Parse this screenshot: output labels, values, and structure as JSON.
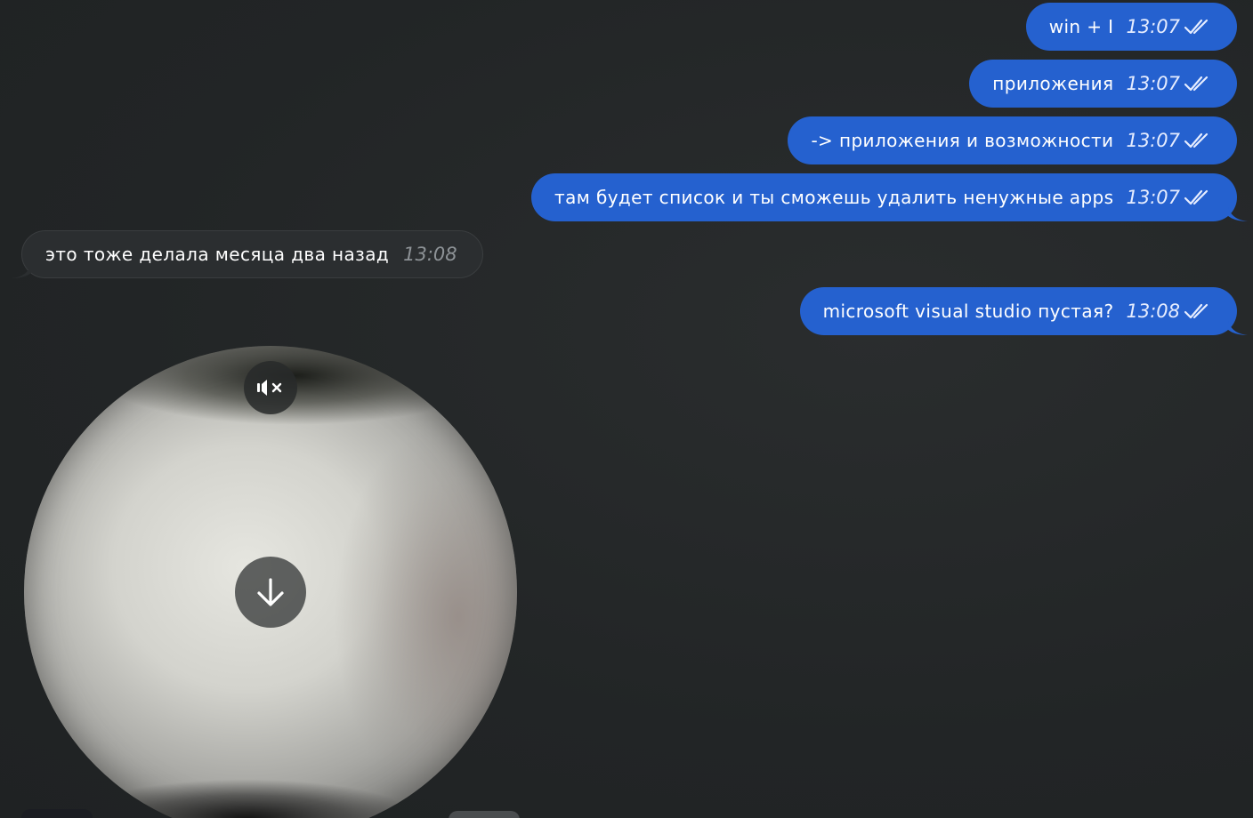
{
  "messages": [
    {
      "direction": "out",
      "text": "win + I",
      "time": "13:07",
      "status": "read"
    },
    {
      "direction": "out",
      "text": "приложения",
      "time": "13:07",
      "status": "read"
    },
    {
      "direction": "out",
      "text": "-> приложения и возможности",
      "time": "13:07",
      "status": "read"
    },
    {
      "direction": "out",
      "text": "там будет список и ты сможешь удалить ненужные apps",
      "time": "13:07",
      "status": "read"
    },
    {
      "direction": "in",
      "text": "это тоже делала месяца два назад",
      "time": "13:08"
    },
    {
      "direction": "out",
      "text": "microsoft visual studio пустая?",
      "time": "13:08",
      "status": "read"
    }
  ],
  "video_message": {
    "muted": true,
    "mute_icon": "speaker-muted-icon",
    "download_icon": "download-arrow-icon"
  },
  "colors": {
    "background": "#232627",
    "outgoing_bubble": "#2561cf",
    "incoming_bubble": "#2b2e30",
    "text": "#ffffff",
    "incoming_time": "#8d9296"
  }
}
